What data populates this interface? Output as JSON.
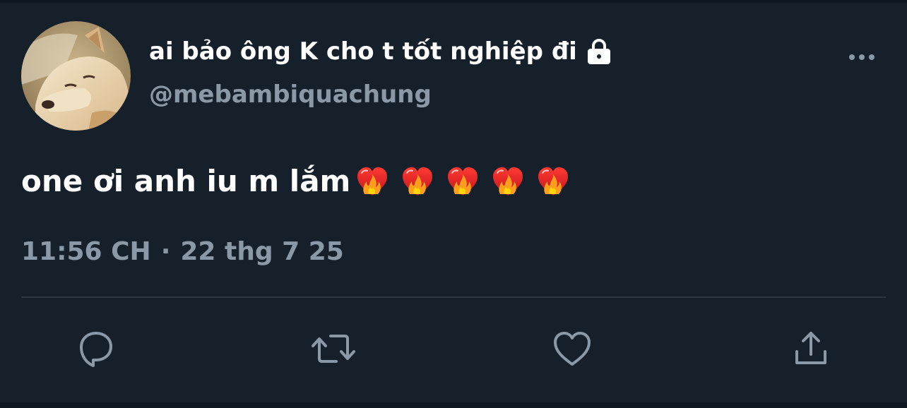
{
  "tweet": {
    "display_name": "ai bảo ông K cho t tốt nghiệp đi",
    "handle": "@mebambiquachung",
    "text": "one ơi anh iu m lắm",
    "emoji": [
      "heart-on-fire",
      "heart-on-fire",
      "heart-on-fire",
      "heart-on-fire",
      "heart-on-fire"
    ],
    "time": "11:56 CH",
    "separator": "·",
    "date": "22 thg 7 25",
    "protected": true
  },
  "actions": {
    "reply_icon": "reply-icon",
    "retweet_icon": "retweet-icon",
    "like_icon": "heart-icon",
    "share_icon": "share-icon",
    "more_icon": "more-dots-icon"
  },
  "colors": {
    "background": "#15202b",
    "primary_text": "#ffffff",
    "secondary_text": "#8b98a5",
    "divider": "#2c3640"
  }
}
